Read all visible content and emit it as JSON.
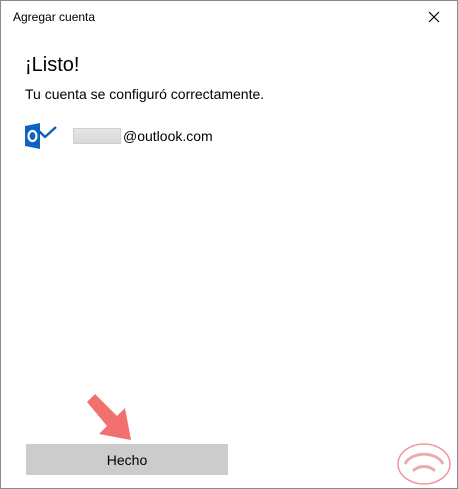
{
  "window": {
    "title": "Agregar cuenta",
    "close_icon": "close-icon"
  },
  "content": {
    "heading": "¡Listo!",
    "message": "Tu cuenta se configuró correctamente.",
    "account": {
      "icon": "outlook-icon",
      "email_suffix": "@outlook.com"
    }
  },
  "footer": {
    "done_label": "Hecho"
  },
  "annotation": {
    "arrow_icon": "pointer-arrow-icon",
    "arrow_color": "#f2706e"
  },
  "colors": {
    "outlook_blue": "#0a64c0",
    "button_bg": "#cccccc",
    "watermark_red": "#d84848"
  }
}
